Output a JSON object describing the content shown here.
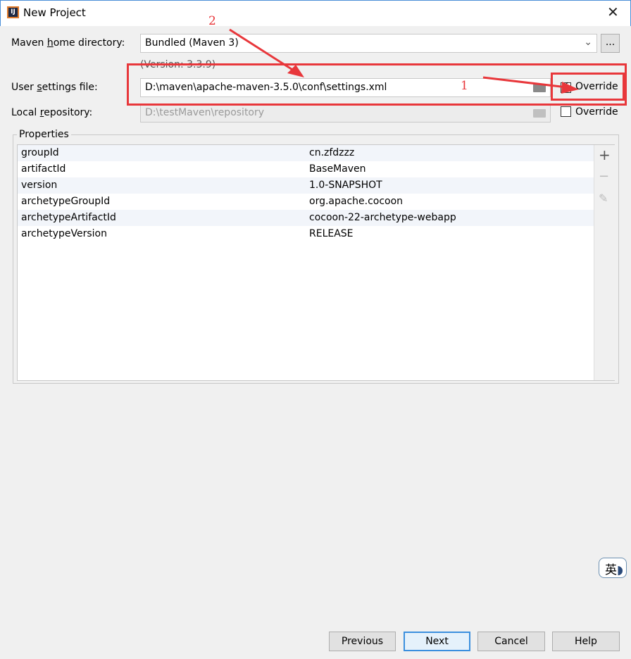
{
  "window": {
    "title": "New Project",
    "close": "✕"
  },
  "maven_home": {
    "label_pre": "Maven ",
    "label_u": "h",
    "label_post": "ome directory:",
    "value": "Bundled (Maven 3)",
    "browse": "...",
    "version": "(Version: 3.3.9)"
  },
  "user_settings": {
    "label_pre": "User ",
    "label_u": "s",
    "label_post": "ettings file:",
    "value": "D:\\maven\\apache-maven-3.5.0\\conf\\settings.xml",
    "override": "Override",
    "override_checked": true
  },
  "local_repo": {
    "label_pre": "Local ",
    "label_u": "r",
    "label_post": "epository:",
    "value": "D:\\testMaven\\repository",
    "override": "Override",
    "override_checked": false
  },
  "properties": {
    "title": "Properties",
    "rows": [
      {
        "key": "groupId",
        "value": "cn.zfdzzz"
      },
      {
        "key": "artifactId",
        "value": "BaseMaven"
      },
      {
        "key": "version",
        "value": "1.0-SNAPSHOT"
      },
      {
        "key": "archetypeGroupId",
        "value": "org.apache.cocoon"
      },
      {
        "key": "archetypeArtifactId",
        "value": "cocoon-22-archetype-webapp"
      },
      {
        "key": "archetypeVersion",
        "value": "RELEASE"
      }
    ],
    "add": "+",
    "remove": "−",
    "edit": "✎"
  },
  "buttons": {
    "previous": "Previous",
    "next": "Next",
    "cancel": "Cancel",
    "help": "Help"
  },
  "ime": {
    "label": "英"
  },
  "annotations": {
    "one": "1",
    "two": "2",
    "color": "#e8373b"
  }
}
